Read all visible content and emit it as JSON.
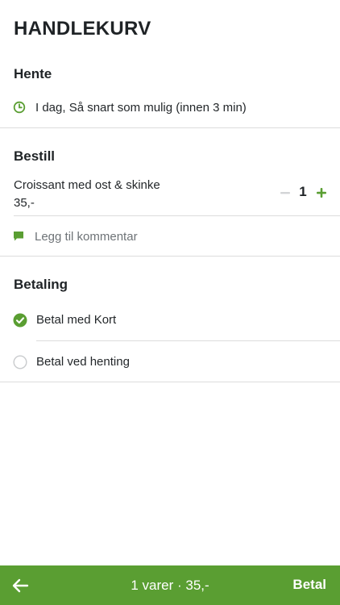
{
  "page": {
    "title": "HANDLEKURV"
  },
  "pickup": {
    "heading": "Hente",
    "time_text": "I dag, Så snart som mulig (innen 3 min)"
  },
  "order": {
    "heading": "Bestill",
    "items": [
      {
        "name": "Croissant med ost & skinke",
        "price": "35,-",
        "quantity": "1"
      }
    ],
    "comment_placeholder": "Legg til kommentar"
  },
  "payment": {
    "heading": "Betaling",
    "options": [
      {
        "label": "Betal med Kort",
        "selected": true
      },
      {
        "label": "Betal ved henting",
        "selected": false
      }
    ]
  },
  "bottom_bar": {
    "summary": "1 varer · 35,-",
    "pay_label": "Betal"
  },
  "colors": {
    "accent": "#5a9e32",
    "divider": "#dcdcdc",
    "text": "#1f2326"
  },
  "icons": {
    "clock": "clock-icon",
    "comment": "comment-icon",
    "check": "check-circle-icon",
    "radio": "radio-empty-icon",
    "minus": "minus-icon",
    "plus": "plus-icon",
    "back": "arrow-left-icon"
  }
}
